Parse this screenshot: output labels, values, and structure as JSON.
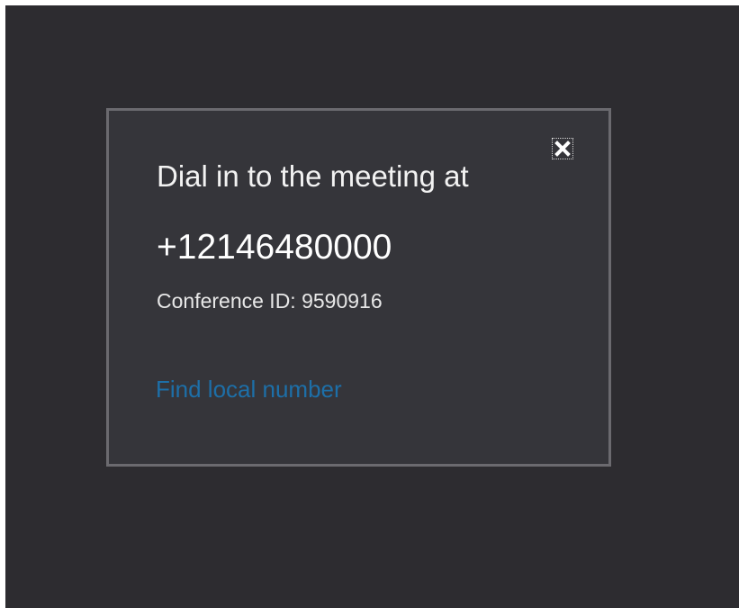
{
  "dialog": {
    "title": "Dial in to the meeting at",
    "phone_number": "+12146480000",
    "conference_id_text": "Conference ID: 9590916",
    "find_local_number_link": "Find local number",
    "close_icon": "close-icon"
  },
  "colors": {
    "window_background": "#2d2c30",
    "dialog_background": "#35353a",
    "dialog_border": "#6b6a6f",
    "link": "#1d6fa8"
  }
}
